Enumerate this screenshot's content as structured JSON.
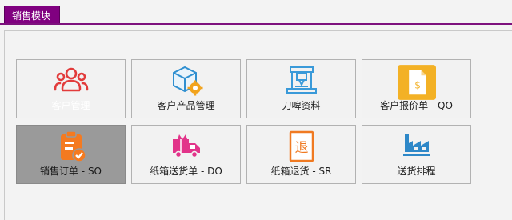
{
  "module_tab": {
    "label": "销售模块"
  },
  "tiles": [
    {
      "label": "客户管理",
      "icon": "users-icon",
      "color": "#e23b3b"
    },
    {
      "label": "客户产品管理",
      "icon": "box-gear-icon",
      "color": "#2f8fd0"
    },
    {
      "label": "刀啤资料",
      "icon": "die-cutter-icon",
      "color": "#3a9ad9"
    },
    {
      "label": "客户报价单 - QO",
      "icon": "quotation-document-icon",
      "color": "#f3b125"
    },
    {
      "label": "销售订单 - SO",
      "icon": "clipboard-check-icon",
      "color": "#f47a20"
    },
    {
      "label": "纸箱送货单 - DO",
      "icon": "delivery-truck-icon",
      "color": "#e2348a"
    },
    {
      "label": "纸箱退货 - SR",
      "icon": "return-goods-icon",
      "color": "#f07a22"
    },
    {
      "label": "送货排程",
      "icon": "factory-schedule-icon",
      "color": "#2e88c8"
    }
  ]
}
